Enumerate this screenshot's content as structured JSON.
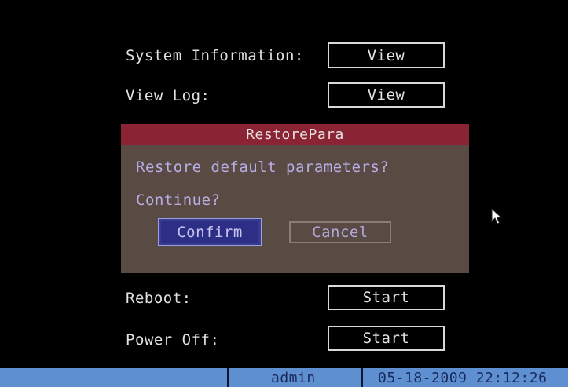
{
  "menu": {
    "system_information_label": "System Information:",
    "system_information_button": "View",
    "view_log_label": "View Log:",
    "view_log_button": "View",
    "reboot_label": "Reboot:",
    "reboot_button": "Start",
    "power_off_label": "Power Off:",
    "power_off_button": "Start"
  },
  "dialog": {
    "title": "RestorePara",
    "message": "Restore default parameters?",
    "prompt": "Continue?",
    "confirm_label": "Confirm",
    "cancel_label": "Cancel"
  },
  "statusbar": {
    "user": "admin",
    "datetime": "05-18-2009 22:12:26"
  },
  "icons": {
    "cursor": "mouse-pointer-icon"
  },
  "colors": {
    "dialog_title_bg": "#8a2333",
    "dialog_body_bg": "#5a4a44",
    "statusbar_bg": "#5e8fd0",
    "selected_button_bg": "#2d2f86"
  }
}
